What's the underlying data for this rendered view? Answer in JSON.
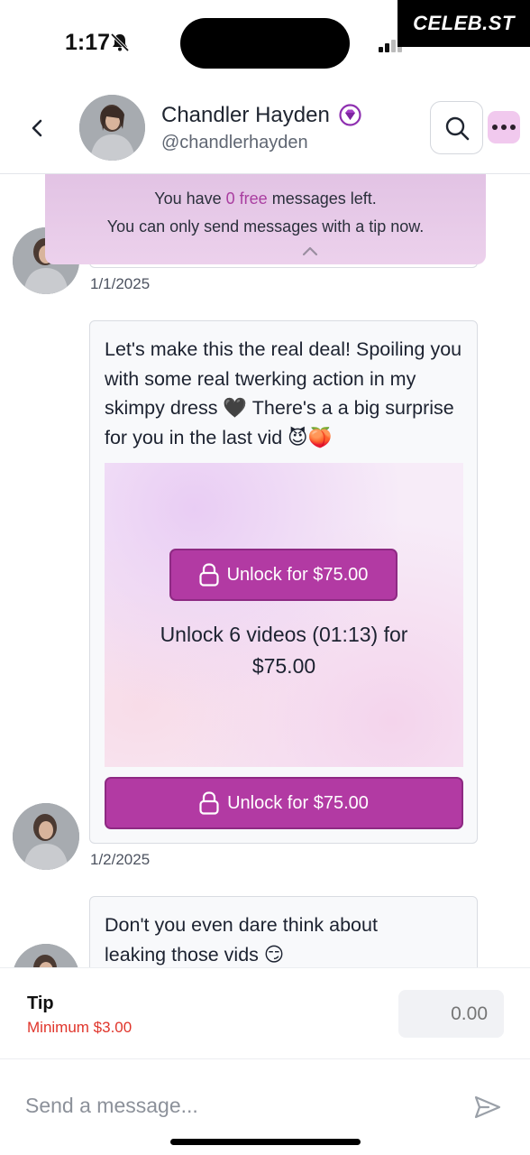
{
  "status_bar": {
    "time": "1:17",
    "watermark": "CELEB.ST"
  },
  "header": {
    "name": "Chandler Hayden",
    "handle": "@chandlerhayden"
  },
  "free_banner": {
    "line1_prefix": "You have",
    "count": "0 free",
    "line1_suffix": "messages left.",
    "line2": "You can only send messages with a tip now."
  },
  "messages": [
    {
      "date": "1/1/2025"
    },
    {
      "text": "Let's make this the real deal! Spoiling you with some real twerking action in my skimpy dress 🖤 There's a a big surprise for you in the last vid 😈🍑",
      "unlock_button": "Unlock for $75.00",
      "unlock_caption": "Unlock 6 videos (01:13) for $75.00",
      "date": "1/2/2025"
    },
    {
      "text": "Don't you even dare think about leaking those vids 😏"
    }
  ],
  "tip": {
    "label": "Tip",
    "minimum": "Minimum $3.00",
    "value": "0.00"
  },
  "composer": {
    "placeholder": "Send a message..."
  },
  "colors": {
    "accent": "#b23aa3",
    "banner": "#e2c3e4",
    "error": "#e0352b"
  }
}
